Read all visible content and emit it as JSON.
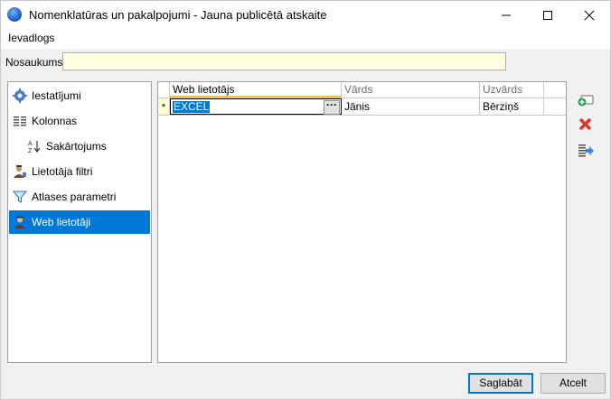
{
  "window": {
    "title": "Nomenklatūras un pakalpojumi - Jauna publicētā atskaite",
    "controls": {
      "minimize": "—",
      "maximize": "☐",
      "close": "✕"
    }
  },
  "menubar": {
    "items": [
      {
        "label": "Ievadlogs"
      }
    ]
  },
  "name_field": {
    "label": "Nosaukums:",
    "value": ""
  },
  "sidebar": {
    "items": [
      {
        "label": "Iestatījumi",
        "icon": "gear-icon"
      },
      {
        "label": "Kolonnas",
        "icon": "columns-icon"
      },
      {
        "label": "Sakārtojums",
        "icon": "sort-az-icon"
      },
      {
        "label": "Lietotāja filtri",
        "icon": "user-filter-icon"
      },
      {
        "label": "Atlases parametri",
        "icon": "funnel-icon"
      },
      {
        "label": "Web lietotāji",
        "icon": "web-user-icon",
        "selected": true
      }
    ]
  },
  "grid": {
    "columns": [
      "Web lietotājs",
      "Vārds",
      "Uzvārds"
    ],
    "new_row_marker": "*",
    "rows": [
      {
        "web_user": "EXCEL",
        "first_name": "Jānis",
        "last_name": "Bērziņš"
      }
    ],
    "ellipsis": "···"
  },
  "side_tools": [
    {
      "icon": "add-row-icon"
    },
    {
      "icon": "delete-icon"
    },
    {
      "icon": "export-icon"
    }
  ],
  "buttons": {
    "save": "Saglabāt",
    "cancel": "Atcelt"
  },
  "colors": {
    "selection": "#0078d7",
    "input_bg": "#ffffe1",
    "header_accent": "#f7c13a"
  }
}
